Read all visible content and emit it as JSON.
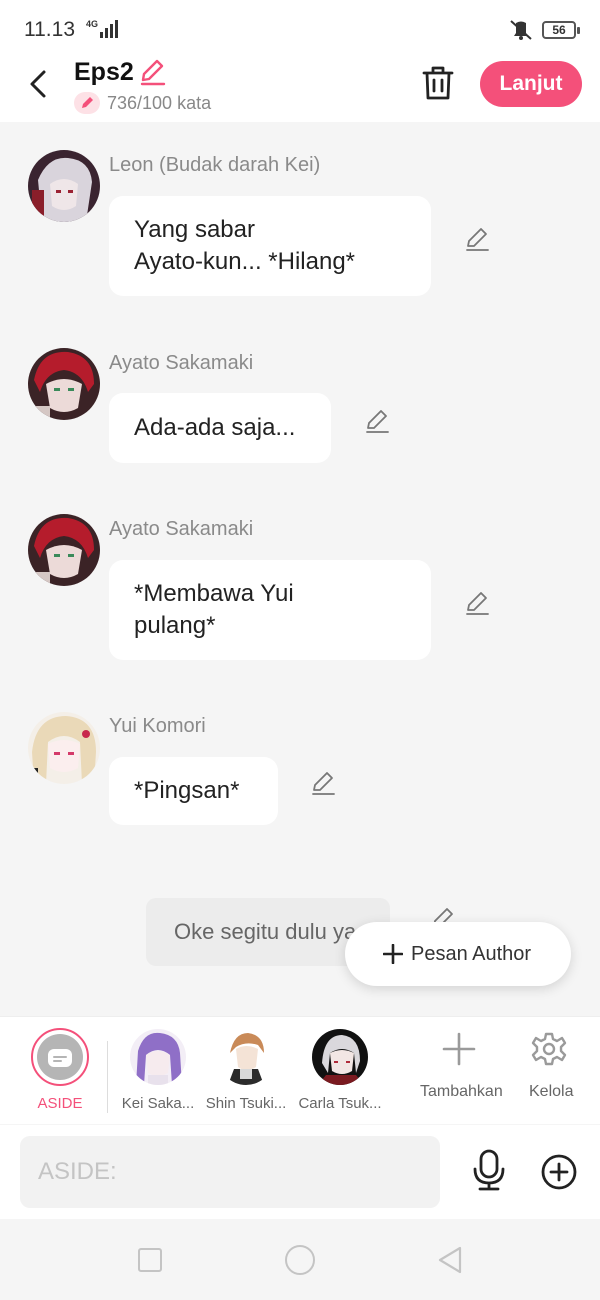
{
  "status_bar": {
    "time": "11.13",
    "network": "4G",
    "battery": "56"
  },
  "header": {
    "title": "Eps2",
    "word_count": "736/100 kata",
    "next_label": "Lanjut"
  },
  "messages": [
    {
      "sender": "Leon (Budak darah Kei)",
      "text_lines": [
        "Yang sabar",
        "Ayato-kun... *Hilang*"
      ]
    },
    {
      "sender": "Ayato Sakamaki",
      "text_lines": [
        "Ada-ada saja..."
      ]
    },
    {
      "sender": "Ayato Sakamaki",
      "text_lines": [
        "*Membawa Yui",
        "pulang*"
      ]
    },
    {
      "sender": "Yui Komori",
      "text_lines": [
        "*Pingsan*"
      ]
    }
  ],
  "author_message": "Oke segitu dulu ya",
  "pesan_author_label": "Pesan Author",
  "characters": [
    {
      "label": "ASIDE",
      "selected": true
    },
    {
      "label": "Kei Saka..."
    },
    {
      "label": "Shin Tsuki..."
    },
    {
      "label": "Carla Tsuk..."
    }
  ],
  "actions": {
    "add_label": "Tambahkan",
    "manage_label": "Kelola"
  },
  "input": {
    "placeholder": "ASIDE:"
  },
  "colors": {
    "accent": "#f4507a",
    "background": "#f5f5f5",
    "bubble": "#ffffff"
  },
  "icons": [
    "back-arrow-icon",
    "pencil-icon",
    "trash-icon",
    "edit-icon",
    "plus-icon",
    "gear-icon",
    "microphone-icon",
    "plus-circle-icon"
  ]
}
